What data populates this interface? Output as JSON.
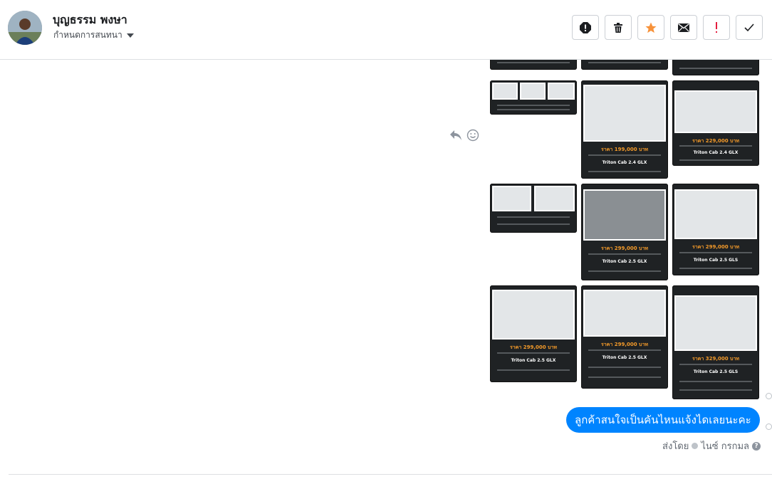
{
  "header": {
    "contact_name": "บุญธรรม พงษา",
    "assign_label": "กำหนดการสนทนา",
    "icons": [
      "spam-icon",
      "trash-icon",
      "star-icon",
      "envelope-icon",
      "exclamation-icon",
      "check-icon"
    ],
    "star_color": "#f7923a",
    "exclaim_color": "#e41e3f"
  },
  "listings": [
    {
      "price": "ราคา 199,000 บาท",
      "model": "Triton Cab 2.4 GLX"
    },
    {
      "price": "ราคา 229,000 บาท",
      "model": "Triton Cab 2.4 GLX"
    },
    {
      "price": "ราคา 299,000 บาท",
      "model": "Triton Cab 2.5 GLX"
    },
    {
      "price": "ราคา 299,000 บาท",
      "model": "Triton Cab 2.5 GLS"
    },
    {
      "price": "ราคา 299,000 บาท",
      "model": "Triton Cab 2.5 GLX"
    },
    {
      "price": "ราคา 299,000 บาท",
      "model": "Triton Cab 2.5 GLX"
    },
    {
      "price": "ราคา 329,000 บาท",
      "model": "Triton Cab 2.5 GLS"
    }
  ],
  "message": {
    "text": "ลูกค้าสนใจเป็นคันไหนแจ้งไดเลยนะคะ",
    "bubble_color": "#0084ff"
  },
  "sent_by": {
    "label": "ส่งโดย",
    "agent": "ไนซ์ กรกมล",
    "help": "?"
  }
}
